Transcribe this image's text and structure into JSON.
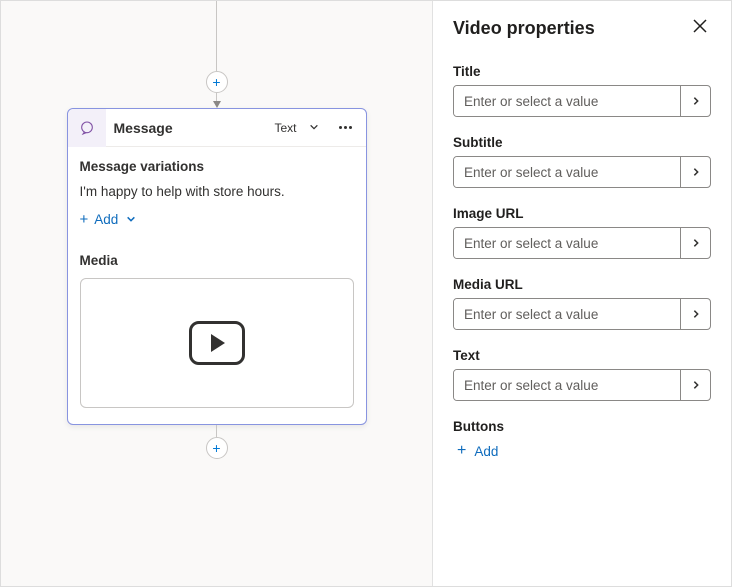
{
  "panel": {
    "title": "Video properties",
    "fields": [
      {
        "label": "Title",
        "placeholder": "Enter or select a value"
      },
      {
        "label": "Subtitle",
        "placeholder": "Enter or select a value"
      },
      {
        "label": "Image URL",
        "placeholder": "Enter or select a value"
      },
      {
        "label": "Media URL",
        "placeholder": "Enter or select a value"
      },
      {
        "label": "Text",
        "placeholder": "Enter or select a value"
      }
    ],
    "buttons_label": "Buttons",
    "add_label": "Add"
  },
  "canvas": {
    "node": {
      "title": "Message",
      "type_label": "Text",
      "variations_label": "Message variations",
      "variation_text": "I'm happy to help with store hours.",
      "add_label": "Add",
      "media_label": "Media"
    }
  }
}
